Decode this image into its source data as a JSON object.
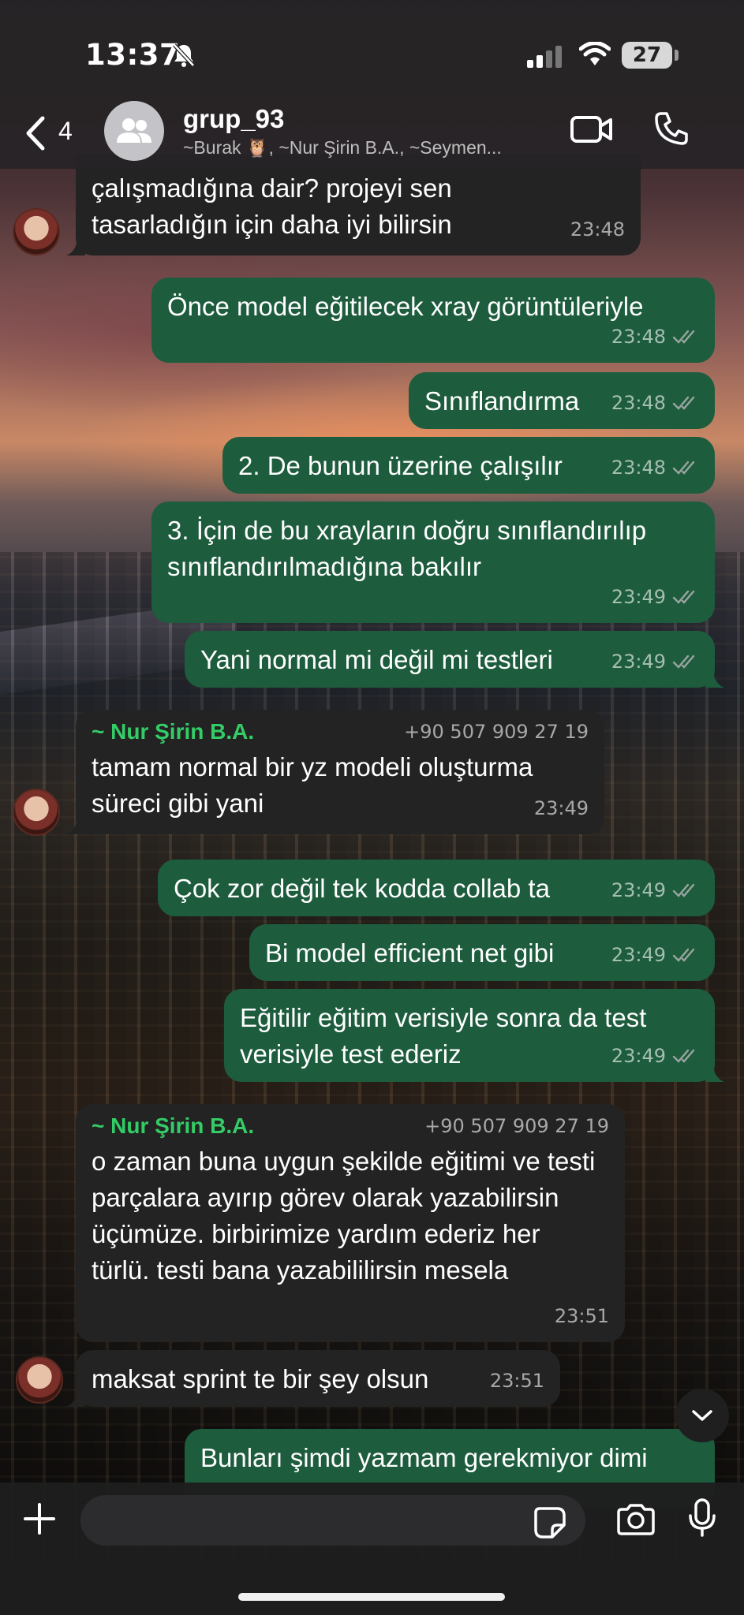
{
  "status": {
    "time": "13:37",
    "battery": "27"
  },
  "header": {
    "back_count": "4",
    "title": "grup_93",
    "members": "~Burak 🦉, ~Nur Şirin B.A., ~Seymen..."
  },
  "messages": [
    {
      "dir": "in",
      "text": "çalışmadığına dair? projeyi sen tasarladığın için daha iyi bilirsin",
      "time": "23:48"
    },
    {
      "dir": "out",
      "text": "Önce model eğitilecek xray görüntüleriyle",
      "time": "23:48"
    },
    {
      "dir": "out",
      "text": "Sınıflandırma",
      "time": "23:48"
    },
    {
      "dir": "out",
      "text": "2. De bunun üzerine çalışılır",
      "time": "23:48"
    },
    {
      "dir": "out",
      "text": "3. İçin de bu xrayların doğru sınıflandırılıp sınıflandırılmadığına bakılır",
      "time": "23:49"
    },
    {
      "dir": "out",
      "text": "Yani normal mi değil mi testleri",
      "time": "23:49"
    },
    {
      "dir": "in",
      "sender": "~ Nur Şirin B.A.",
      "phone": "+90 507 909 27 19",
      "text": "tamam normal bir yz modeli oluşturma süreci gibi yani",
      "time": "23:49"
    },
    {
      "dir": "out",
      "text": "Çok zor değil tek kodda collab ta",
      "time": "23:49"
    },
    {
      "dir": "out",
      "text": "Bi model efficient net gibi",
      "time": "23:49"
    },
    {
      "dir": "out",
      "text": "Eğitilir eğitim verisiyle sonra da test verisiyle test ederiz",
      "time": "23:49"
    },
    {
      "dir": "in",
      "sender": "~ Nur Şirin B.A.",
      "phone": "+90 507 909 27 19",
      "text": "o zaman buna uygun şekilde eğitimi ve testi parçalara ayırıp görev olarak yazabilirsin üçümüze. birbirimize yardım ederiz her türlü. testi bana yazabililirsin mesela",
      "time": "23:51"
    },
    {
      "dir": "in",
      "text": "maksat sprint te bir şey olsun",
      "time": "23:51"
    },
    {
      "dir": "out",
      "text": "Bunları şimdi yazmam gerekmiyor dimi",
      "time": ""
    }
  ],
  "composer": {
    "placeholder": ""
  },
  "colors": {
    "outgoing": "#1d5c3d",
    "incoming": "#232323",
    "sender": "#33cc66"
  }
}
